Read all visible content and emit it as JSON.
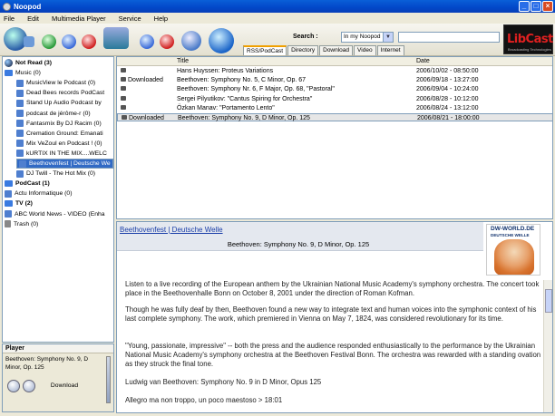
{
  "window": {
    "title": "Noopod"
  },
  "menu": [
    "File",
    "Edit",
    "Multimedia Player",
    "Service",
    "Help"
  ],
  "search": {
    "label": "Search :",
    "scope": "In my Noopod",
    "query": ""
  },
  "tabs": [
    "RSS/PodCast",
    "Directory",
    "Download",
    "Video",
    "Internet"
  ],
  "logo": {
    "text": "LibCast",
    "tagline": "Broadcasting Technologies"
  },
  "tree": [
    {
      "label": "Not Read (3)",
      "bold": true,
      "icon": "globe",
      "indent": 0
    },
    {
      "label": "Music (0)",
      "bold": false,
      "icon": "folder",
      "indent": 0
    },
    {
      "label": "MusicView le Podcast (0)",
      "icon": "rss",
      "indent": 1
    },
    {
      "label": "Dead Bees records PodCast",
      "icon": "rss",
      "indent": 1
    },
    {
      "label": "Stand Up Audio Podcast by",
      "icon": "rss",
      "indent": 1
    },
    {
      "label": "podcast de jérôme-r (0)",
      "icon": "rss",
      "indent": 1
    },
    {
      "label": "Fantasmix By DJ Racim (0)",
      "icon": "rss",
      "indent": 1
    },
    {
      "label": "Cremation Ground: Emanati",
      "icon": "rss",
      "indent": 1
    },
    {
      "label": "Mix VeZoul en Podcast ! (0)",
      "icon": "rss",
      "indent": 1
    },
    {
      "label": "kURTIX IN THE MIX....WELC",
      "icon": "rss",
      "indent": 1
    },
    {
      "label": "Beethovenfest | Deutsche We",
      "icon": "rss",
      "indent": 1,
      "selected": true
    },
    {
      "label": "DJ Twill - The Hot Mix (0)",
      "icon": "rss",
      "indent": 1
    },
    {
      "label": "PodCast (1)",
      "bold": true,
      "icon": "folder",
      "indent": 0
    },
    {
      "label": "Actu Informatique (0)",
      "icon": "rss",
      "indent": 0
    },
    {
      "label": "TV (2)",
      "bold": true,
      "icon": "folder",
      "indent": 0
    },
    {
      "label": "ABC World News - VIDEO (Enha",
      "icon": "rss",
      "indent": 0
    },
    {
      "label": "Trash (0)",
      "icon": "trash",
      "indent": 0
    }
  ],
  "player": {
    "header": "Player",
    "title": "Beethoven: Symphony No. 9, D Minor, Op. 125",
    "download_label": "Download"
  },
  "grid": {
    "columns": [
      "Title",
      "Date"
    ],
    "rows": [
      {
        "status": "",
        "title": "Hans Huyssen: Proteus Variations",
        "date": "2006/10/02 - 08:50:00"
      },
      {
        "status": "Downloaded",
        "title": "Beethoven: Symphony No. 5, C Minor, Op. 67",
        "date": "2006/09/18 - 13:27:00"
      },
      {
        "status": "",
        "title": "Beethoven: Symphony Nr. 6, F Major, Op. 68, \"Pastoral\"",
        "date": "2006/09/04 - 10:24:00"
      },
      {
        "status": "",
        "title": "Sergei Pilyutikov: \"Cantus Spiring for Orchestra\"",
        "date": "2006/08/28 - 10:12:00"
      },
      {
        "status": "",
        "title": "Özkan Manav: \"Portamento Lento\"",
        "date": "2006/08/24 - 13:12:00"
      },
      {
        "status": "Downloaded",
        "title": "Beethoven: Symphony No. 9, D Minor, Op. 125",
        "date": "2006/08/21 - 18:00:00",
        "selected": true
      }
    ]
  },
  "detail": {
    "feed_link": "Beethovenfest | Deutsche Welle",
    "subtitle": "Beethoven: Symphony No. 9, D Minor, Op. 125",
    "badge_line1": "DW-WORLD.DE",
    "badge_line2": "DEUTSCHE WELLE",
    "paragraphs": [
      "Listen to a live recording of the European anthem by the Ukrainian National Music Academy's symphony orchestra. The concert took place in the Beethovenhalle Bonn on October 8, 2001 under the direction of Roman Kofman.",
      "Though he was fully deaf by then, Beethoven found a new way to integrate text and human voices into the symphonic context of his last complete symphony. The work, which premiered in Vienna on May 7, 1824, was considered revolutionary for its time.",
      "\"Young, passionate, impressive\" -- both the press and the audience responded enthusiastically to the performance by the Ukrainian National Music Academy's symphony orchestra at the Beethoven Festival Bonn. The orchestra was rewarded with a standing ovation as they struck the final tone.",
      "Ludwig van Beethoven: Symphony No. 9 in D Minor, Opus 125",
      "Allegro ma non troppo, un poco maestoso > 18:01"
    ]
  }
}
